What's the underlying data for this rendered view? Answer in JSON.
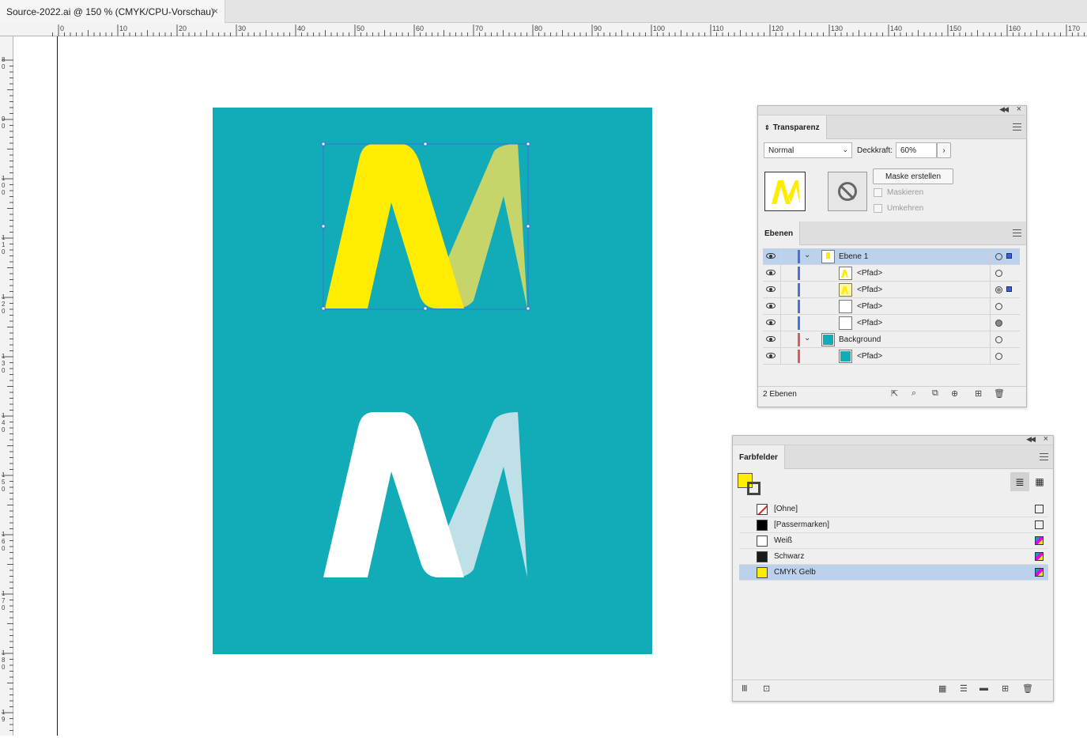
{
  "document": {
    "tab_title": "Source-2022.ai @ 150 % (CMYK/CPU-Vorschau)",
    "close_glyph": "×"
  },
  "ruler": {
    "top_labels": [
      "0",
      "10",
      "20",
      "30",
      "40",
      "50",
      "60",
      "70",
      "80",
      "90",
      "100",
      "110",
      "120",
      "130",
      "140",
      "150",
      "160",
      "170"
    ],
    "left_labels": [
      "8\n0",
      "9\n0",
      "1\n0\n0",
      "1\n1\n0",
      "1\n2\n0",
      "1\n3\n0",
      "1\n4\n0",
      "1\n5\n0",
      "1\n6\n0",
      "1\n7\n0",
      "1\n8\n0",
      "1\n9"
    ]
  },
  "colors": {
    "artboard": "#12acb9",
    "yellow": "#ffec00",
    "olive": "#c6d46a",
    "light_teal": "#bfe0e6",
    "selection": "#3a6fd6",
    "layer_blue": "#4a6fe0",
    "layer_red": "#e05a5a"
  },
  "transparency_panel": {
    "tab": "Transparenz",
    "blend_mode": "Normal",
    "opacity_label": "Deckkraft:",
    "opacity_value": "60%",
    "make_mask_button": "Maske erstellen",
    "clip_label": "Maskieren",
    "invert_label": "Umkehren"
  },
  "layers_panel": {
    "tab": "Ebenen",
    "rows": [
      {
        "name": "Ebene 1",
        "indent": 0,
        "expanded": true,
        "selected": true,
        "bar": "blue",
        "thumb": "yellow-layer",
        "target": "empty",
        "has_selection": true
      },
      {
        "name": "<Pfad>",
        "indent": 1,
        "selected": false,
        "bar": "blue",
        "thumb": "yellow-m",
        "target": "empty",
        "has_selection": false
      },
      {
        "name": "<Pfad>",
        "indent": 1,
        "selected": false,
        "bar": "blue",
        "thumb": "olive-m",
        "target": "double",
        "has_selection": true
      },
      {
        "name": "<Pfad>",
        "indent": 1,
        "selected": false,
        "bar": "blue",
        "thumb": "white",
        "target": "empty",
        "has_selection": false
      },
      {
        "name": "<Pfad>",
        "indent": 1,
        "selected": false,
        "bar": "blue",
        "thumb": "white",
        "target": "filled",
        "has_selection": false
      },
      {
        "name": "Background",
        "indent": 0,
        "expanded": true,
        "selected": false,
        "bar": "red",
        "thumb": "teal",
        "target": "empty",
        "has_selection": false
      },
      {
        "name": "<Pfad>",
        "indent": 1,
        "selected": false,
        "bar": "red",
        "thumb": "teal",
        "target": "empty",
        "has_selection": false
      }
    ],
    "footer_count": "2 Ebenen"
  },
  "swatches_panel": {
    "tab": "Farbfelder",
    "rows": [
      {
        "name": "[Ohne]",
        "chip": "none",
        "selected": false
      },
      {
        "name": "[Passermarken]",
        "chip": "#000000",
        "selected": false
      },
      {
        "name": "Weiß",
        "chip": "#ffffff",
        "selected": false
      },
      {
        "name": "Schwarz",
        "chip": "#1b1b1b",
        "selected": false
      },
      {
        "name": "CMYK Gelb",
        "chip": "#ffec00",
        "selected": true
      }
    ]
  }
}
